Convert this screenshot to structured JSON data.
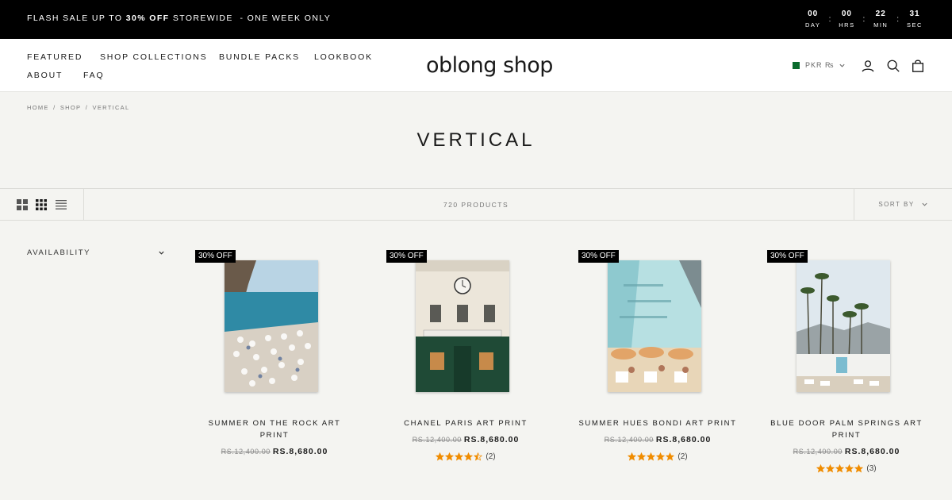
{
  "announcement": {
    "text_before": "Flash sale up to ",
    "text_bold": "30% off",
    "text_after": " storewide  - One week only"
  },
  "countdown": [
    {
      "value": "00",
      "label": "DAY"
    },
    {
      "value": "00",
      "label": "HRS"
    },
    {
      "value": "22",
      "label": "MIN"
    },
    {
      "value": "31",
      "label": "SEC"
    }
  ],
  "nav": {
    "featured": "Featured",
    "shop_collections": "Shop Collections",
    "bundle_packs": "Bundle Packs",
    "lookbook": "Lookbook",
    "about": "About",
    "faq": "FAQ"
  },
  "logo": "oblong shop",
  "currency": "PKR ₨",
  "breadcrumb": {
    "home": "Home",
    "sep": "/",
    "shop": "Shop",
    "current": "Vertical"
  },
  "page_title": "Vertical",
  "toolbar": {
    "product_count": "720 products",
    "sort_label": "Sort by"
  },
  "filter": {
    "availability": "Availability"
  },
  "products": [
    {
      "badge": "30% OFF",
      "title": "Summer On The Rock Art Print",
      "compare_price": "Rs.12,400.00",
      "sale_price": "Rs.8,680.00",
      "rating": 0,
      "review_count": ""
    },
    {
      "badge": "30% OFF",
      "title": "Chanel Paris Art Print",
      "compare_price": "Rs.12,400.00",
      "sale_price": "Rs.8,680.00",
      "rating": 4.5,
      "review_count": "(2)"
    },
    {
      "badge": "30% OFF",
      "title": "Summer Hues Bondi Art Print",
      "compare_price": "Rs.12,400.00",
      "sale_price": "Rs.8,680.00",
      "rating": 5,
      "review_count": "(2)"
    },
    {
      "badge": "30% OFF",
      "title": "Blue Door Palm Springs Art Print",
      "compare_price": "Rs.12,400.00",
      "sale_price": "Rs.8,680.00",
      "rating": 5,
      "review_count": "(3)"
    }
  ],
  "colors": {
    "star": "#f08c00",
    "badge_bg": "#000000",
    "page_bg": "#f4f4f1"
  }
}
